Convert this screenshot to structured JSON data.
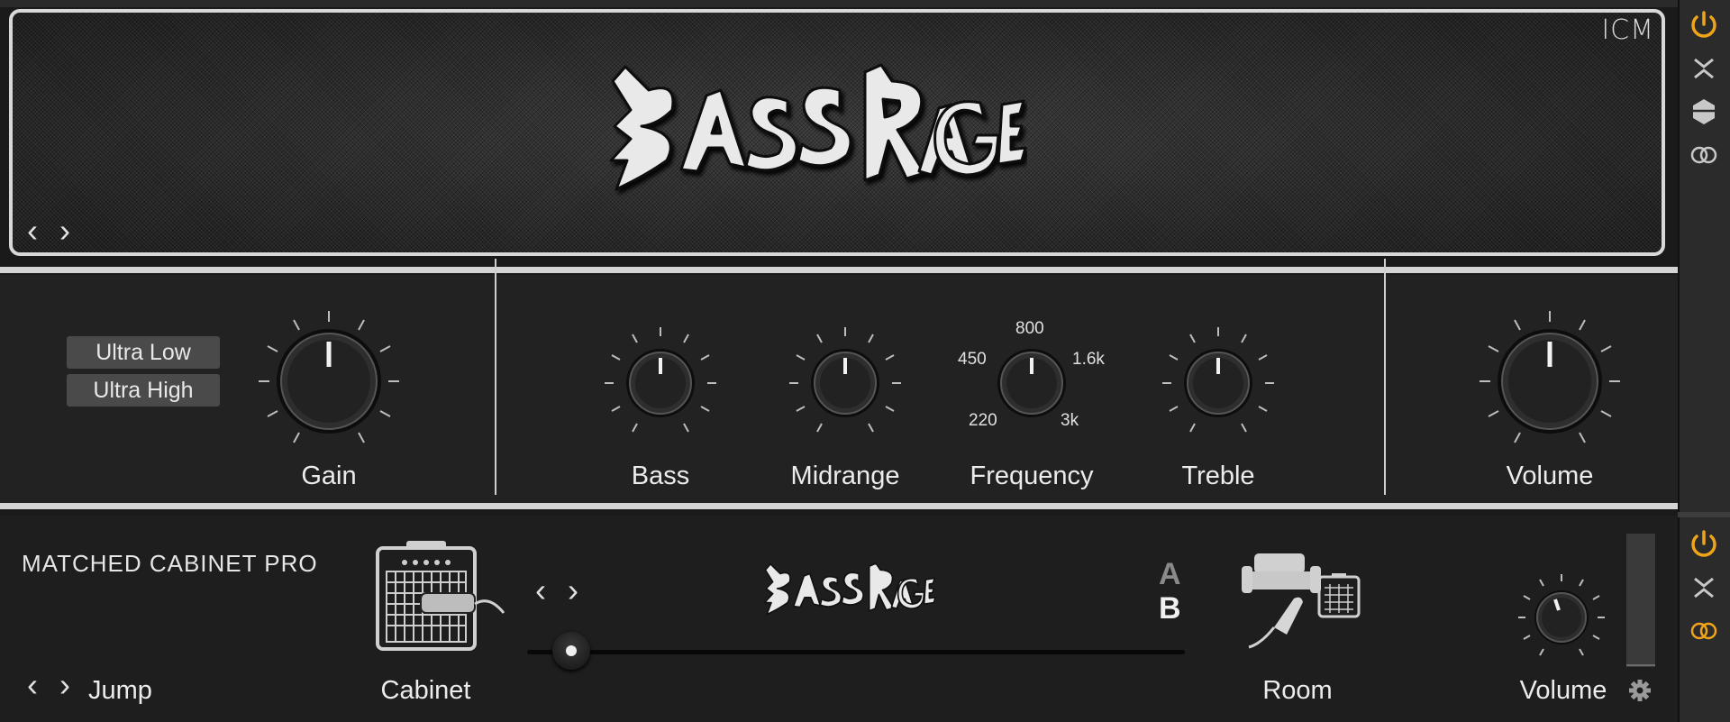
{
  "amp": {
    "brand": "ICM",
    "logo_text": "BASS RAGE",
    "preset_prev": "‹",
    "preset_next": "›",
    "mode_buttons": [
      "Ultra Low",
      "Ultra High"
    ],
    "knobs": {
      "gain": "Gain",
      "bass": "Bass",
      "midrange": "Midrange",
      "frequency": "Frequency",
      "treble": "Treble",
      "volume": "Volume"
    },
    "frequency_scale": {
      "top": "800",
      "left": "450",
      "right": "1.6k",
      "bottom_left": "220",
      "bottom_right": "3k"
    }
  },
  "cabinet": {
    "title": "MATCHED CABINET PRO",
    "jump_label": "Jump",
    "cabinet_label": "Cabinet",
    "room_label": "Room",
    "volume_label": "Volume",
    "logo_text": "BASS RAGE",
    "ab_a": "A",
    "ab_b": "B",
    "mic_position": 0.06,
    "selected_slot": "B"
  },
  "sidebar": {
    "icons": [
      "power-icon",
      "collapse-icon",
      "hexagon-icon",
      "link-rings-icon"
    ]
  },
  "colors": {
    "accent": "#f0a419",
    "panel": "#222222",
    "separator": "#d4d4d4"
  }
}
